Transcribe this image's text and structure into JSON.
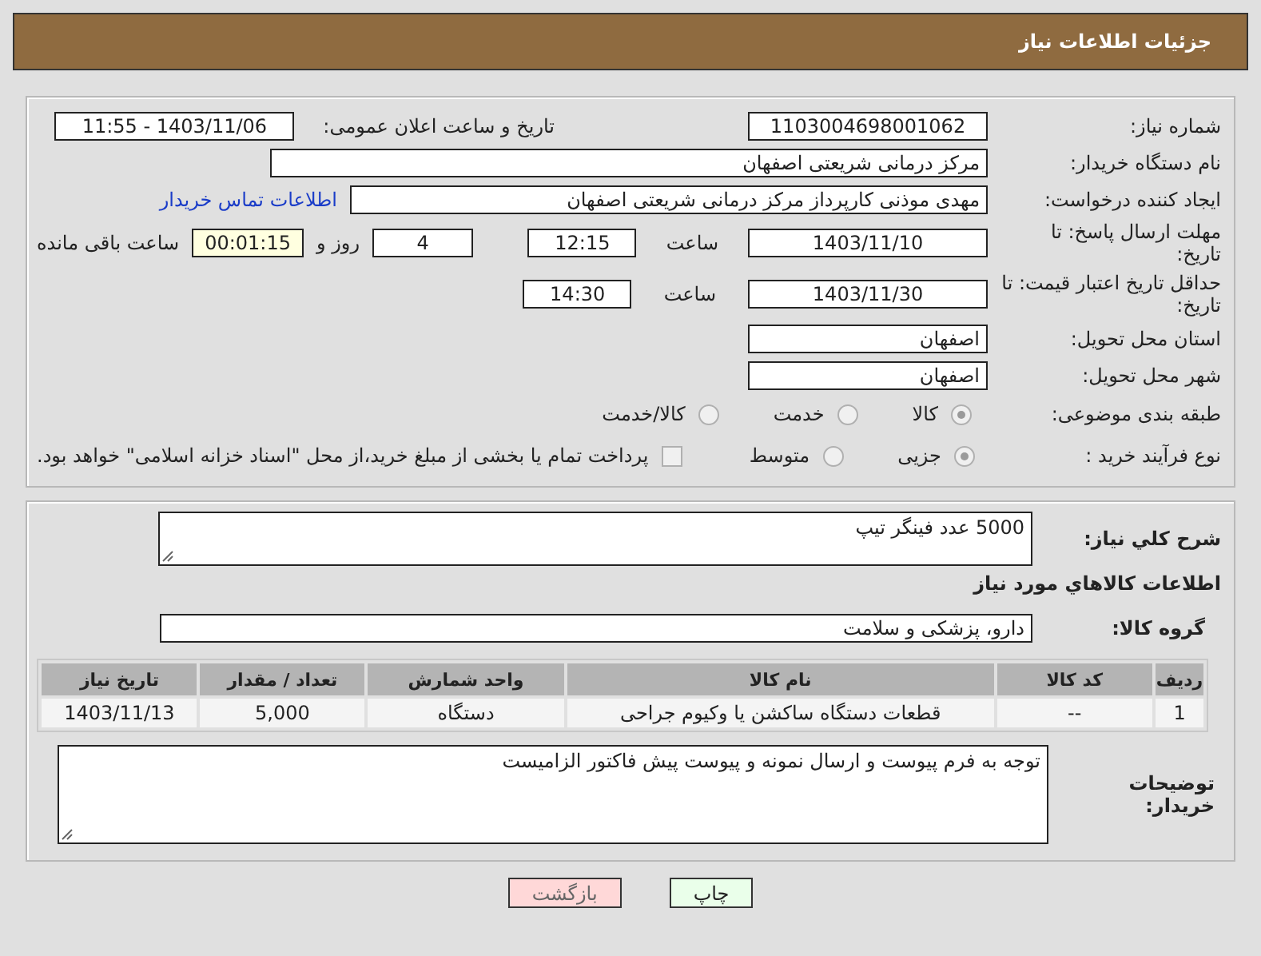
{
  "header": {
    "title": "جزئیات اطلاعات نیاز"
  },
  "details": {
    "need_number": {
      "label": "شماره نیاز:",
      "value": "1103004698001062"
    },
    "announce": {
      "label": "تاریخ و ساعت اعلان عمومی:",
      "value": "1403/11/06 - 11:55"
    },
    "buyer_org": {
      "label": "نام دستگاه خریدار:",
      "value": "مرکز درمانی شریعتی اصفهان"
    },
    "requester": {
      "label": "ایجاد کننده درخواست:",
      "value": "مهدی موذنی کارپرداز مرکز درمانی شریعتی اصفهان",
      "link": "اطلاعات تماس خریدار"
    },
    "reply_deadline": {
      "label": "مهلت ارسال پاسخ: تا تاریخ:",
      "date": "1403/11/10",
      "time_label": "ساعت",
      "time": "12:15",
      "days": "4",
      "days_label": "روز و",
      "remaining": "00:01:15",
      "remaining_label": "ساعت باقی مانده"
    },
    "price_validity": {
      "label": "حداقل تاریخ اعتبار قیمت: تا تاریخ:",
      "date": "1403/11/30",
      "time_label": "ساعت",
      "time": "14:30"
    },
    "province": {
      "label": "استان محل تحویل:",
      "value": "اصفهان"
    },
    "city": {
      "label": "شهر محل تحویل:",
      "value": "اصفهان"
    },
    "category": {
      "label": "طبقه بندی موضوعی:",
      "options": [
        {
          "label": "كالا",
          "selected": true
        },
        {
          "label": "خدمت",
          "selected": false
        },
        {
          "label": "كالا/خدمت",
          "selected": false
        }
      ]
    },
    "process": {
      "label": "نوع فرآیند خرید :",
      "options": [
        {
          "label": "جزیی",
          "selected": true
        },
        {
          "label": "متوسط",
          "selected": false
        }
      ],
      "treasury": {
        "label": "پرداخت تمام یا بخشی از مبلغ خرید،از محل \"اسناد خزانه اسلامی\" خواهد بود.",
        "checked": false
      }
    }
  },
  "goods": {
    "description": {
      "label": "شرح کلي نياز:",
      "value": "5000 عدد فینگر تیپ"
    },
    "section_title": "اطلاعات کالاهاي مورد نياز",
    "group": {
      "label": "گروه کالا:",
      "value": "دارو، پزشکی و سلامت"
    },
    "table": {
      "columns": [
        "ردیف",
        "کد کالا",
        "نام کالا",
        "واحد شمارش",
        "تعداد / مقدار",
        "تاریخ نیاز"
      ],
      "rows": [
        [
          "1",
          "--",
          "قطعات دستگاه ساکشن یا وکیوم جراحی",
          "دستگاه",
          "5,000",
          "1403/11/13"
        ]
      ]
    },
    "buyer_notes": {
      "label": "توضیحات خریدار:",
      "value": "توجه به فرم پیوست و ارسال نمونه و پیوست پیش فاکتور الزامیست"
    }
  },
  "buttons": [
    {
      "label": "چاپ",
      "kind": "print"
    },
    {
      "label": "بازگشت",
      "kind": "back"
    }
  ]
}
